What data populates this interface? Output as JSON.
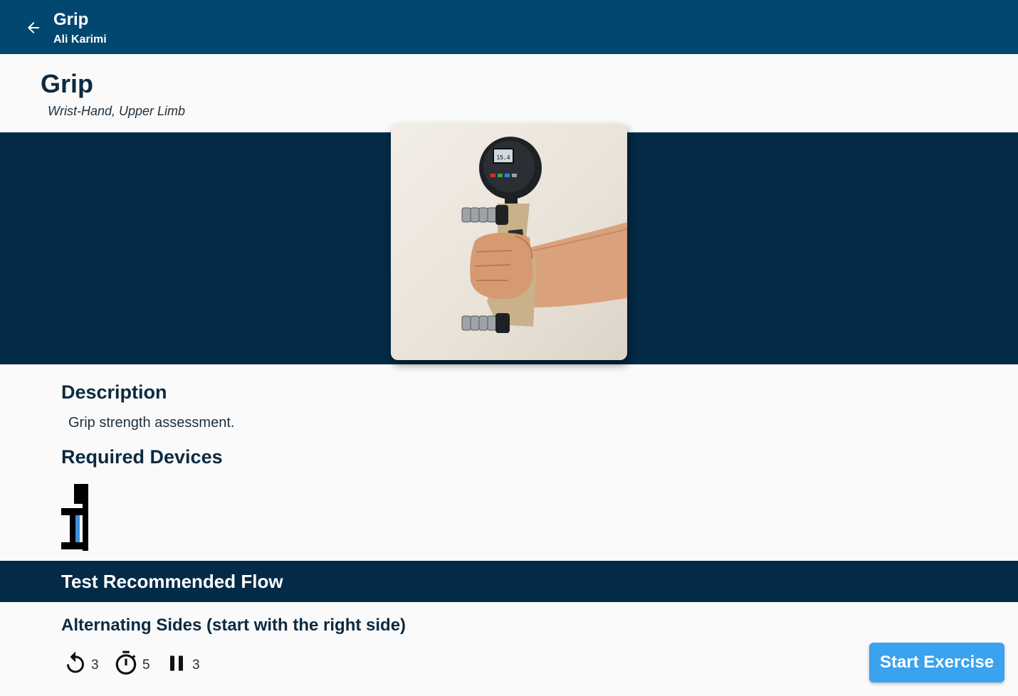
{
  "appbar": {
    "title": "Grip",
    "subtitle": "Ali Karimi"
  },
  "exercise": {
    "title": "Grip",
    "subtitle": "Wrist-Hand, Upper Limb",
    "image_desc": "hand gripping digital hand dynamometer"
  },
  "description": {
    "heading": "Description",
    "text": "Grip strength assessment."
  },
  "devices": {
    "heading": "Required Devices",
    "items": [
      "dynamometer-icon"
    ]
  },
  "flow": {
    "heading": "Test Recommended Flow",
    "mode": "Alternating Sides (start with the right side)",
    "stats": {
      "repetitions": "3",
      "duration": "5",
      "rest": "3"
    }
  },
  "actions": {
    "start_label": "Start Exercise"
  },
  "colors": {
    "appbar": "#02476f",
    "dark_band": "#032a47",
    "button": "#3aa2ef"
  }
}
